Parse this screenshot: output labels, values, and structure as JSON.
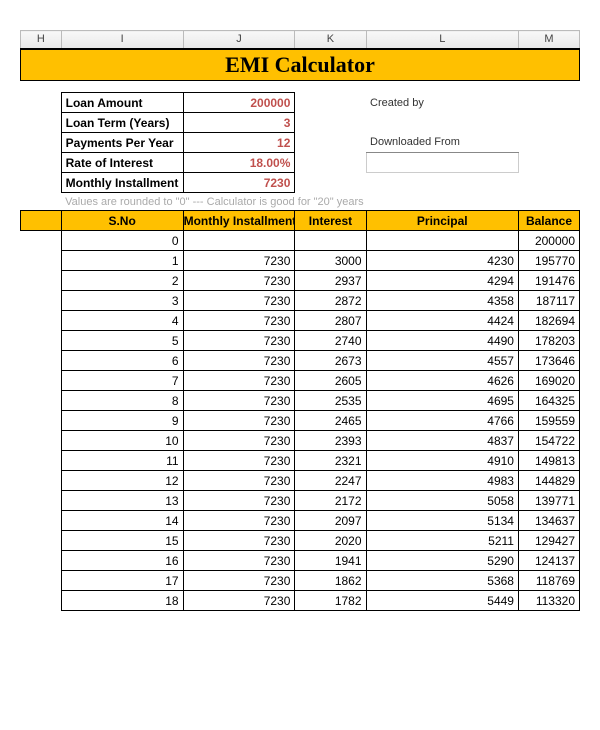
{
  "cols": [
    "H",
    "I",
    "J",
    "K",
    "L",
    "M"
  ],
  "title": "EMI Calculator",
  "info": {
    "loan_amount_label": "Loan Amount",
    "loan_amount": "200000",
    "loan_term_label": "Loan Term (Years)",
    "loan_term": "3",
    "payments_label": "Payments Per Year",
    "payments": "12",
    "rate_label": "Rate of Interest",
    "rate": "18.00%",
    "installment_label": "Monthly Installment",
    "installment": "7230",
    "created_by": "Created by",
    "downloaded_from": "Downloaded From"
  },
  "note": "Values are rounded to \"0\"  ---  Calculator is good for \"20\" years",
  "headers": {
    "sno": "S.No",
    "mi": "Monthly Installment",
    "interest": "Interest",
    "principal": "Principal",
    "balance": "Balance"
  },
  "rows": [
    {
      "sno": "0",
      "mi": "",
      "interest": "",
      "principal": "",
      "balance": "200000"
    },
    {
      "sno": "1",
      "mi": "7230",
      "interest": "3000",
      "principal": "4230",
      "balance": "195770"
    },
    {
      "sno": "2",
      "mi": "7230",
      "interest": "2937",
      "principal": "4294",
      "balance": "191476"
    },
    {
      "sno": "3",
      "mi": "7230",
      "interest": "2872",
      "principal": "4358",
      "balance": "187117"
    },
    {
      "sno": "4",
      "mi": "7230",
      "interest": "2807",
      "principal": "4424",
      "balance": "182694"
    },
    {
      "sno": "5",
      "mi": "7230",
      "interest": "2740",
      "principal": "4490",
      "balance": "178203"
    },
    {
      "sno": "6",
      "mi": "7230",
      "interest": "2673",
      "principal": "4557",
      "balance": "173646"
    },
    {
      "sno": "7",
      "mi": "7230",
      "interest": "2605",
      "principal": "4626",
      "balance": "169020"
    },
    {
      "sno": "8",
      "mi": "7230",
      "interest": "2535",
      "principal": "4695",
      "balance": "164325"
    },
    {
      "sno": "9",
      "mi": "7230",
      "interest": "2465",
      "principal": "4766",
      "balance": "159559"
    },
    {
      "sno": "10",
      "mi": "7230",
      "interest": "2393",
      "principal": "4837",
      "balance": "154722"
    },
    {
      "sno": "11",
      "mi": "7230",
      "interest": "2321",
      "principal": "4910",
      "balance": "149813"
    },
    {
      "sno": "12",
      "mi": "7230",
      "interest": "2247",
      "principal": "4983",
      "balance": "144829"
    },
    {
      "sno": "13",
      "mi": "7230",
      "interest": "2172",
      "principal": "5058",
      "balance": "139771"
    },
    {
      "sno": "14",
      "mi": "7230",
      "interest": "2097",
      "principal": "5134",
      "balance": "134637"
    },
    {
      "sno": "15",
      "mi": "7230",
      "interest": "2020",
      "principal": "5211",
      "balance": "129427"
    },
    {
      "sno": "16",
      "mi": "7230",
      "interest": "1941",
      "principal": "5290",
      "balance": "124137"
    },
    {
      "sno": "17",
      "mi": "7230",
      "interest": "1862",
      "principal": "5368",
      "balance": "118769"
    },
    {
      "sno": "18",
      "mi": "7230",
      "interest": "1782",
      "principal": "5449",
      "balance": "113320"
    }
  ]
}
